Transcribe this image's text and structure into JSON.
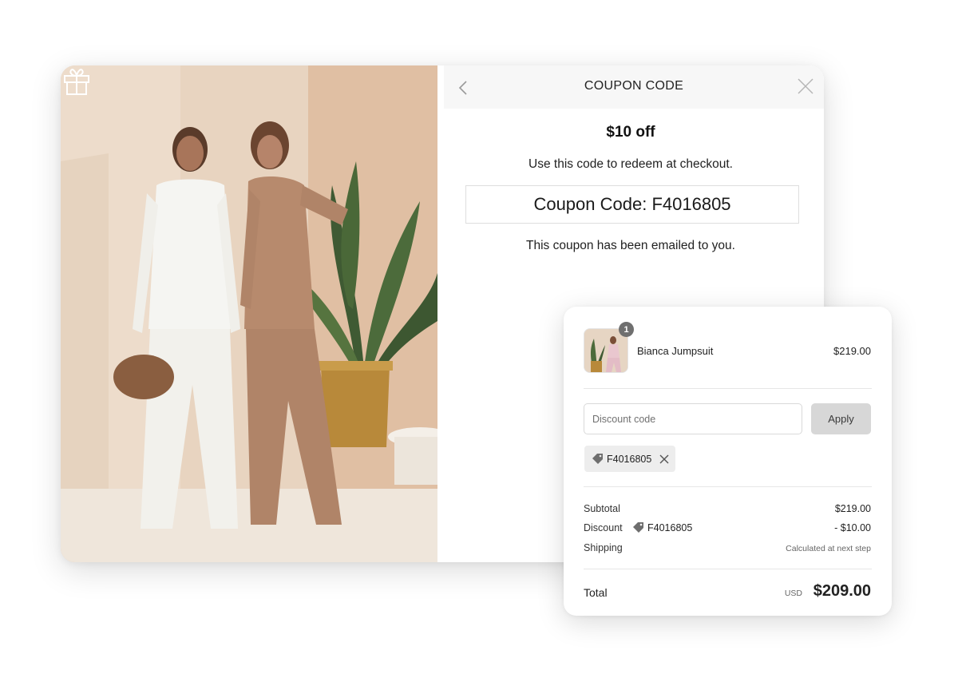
{
  "popup": {
    "title": "COUPON CODE",
    "offer": "$10 off",
    "instructions": "Use this code to redeem at checkout.",
    "coupon_line": "Coupon Code: F4016805",
    "emailed_note": "This coupon has been emailed to you.",
    "icons": {
      "back": "chevron-left-icon",
      "close": "close-icon",
      "gift": "gift-icon"
    }
  },
  "checkout": {
    "item": {
      "quantity": "1",
      "name": "Bianca Jumpsuit",
      "price": "$219.00"
    },
    "discount_input": {
      "placeholder": "Discount code",
      "value": ""
    },
    "apply_label": "Apply",
    "applied_code": "F4016805",
    "summary": {
      "subtotal_label": "Subtotal",
      "subtotal_value": "$219.00",
      "discount_label": "Discount",
      "discount_code": "F4016805",
      "discount_value": "- $10.00",
      "shipping_label": "Shipping",
      "shipping_value": "Calculated at next step",
      "total_label": "Total",
      "currency": "USD",
      "total_value": "$209.00"
    }
  },
  "colors": {
    "apply_button_bg": "#d7d7d7",
    "chip_bg": "#ededed",
    "header_bg": "#f7f7f7",
    "badge_bg": "#6f6f6f"
  }
}
